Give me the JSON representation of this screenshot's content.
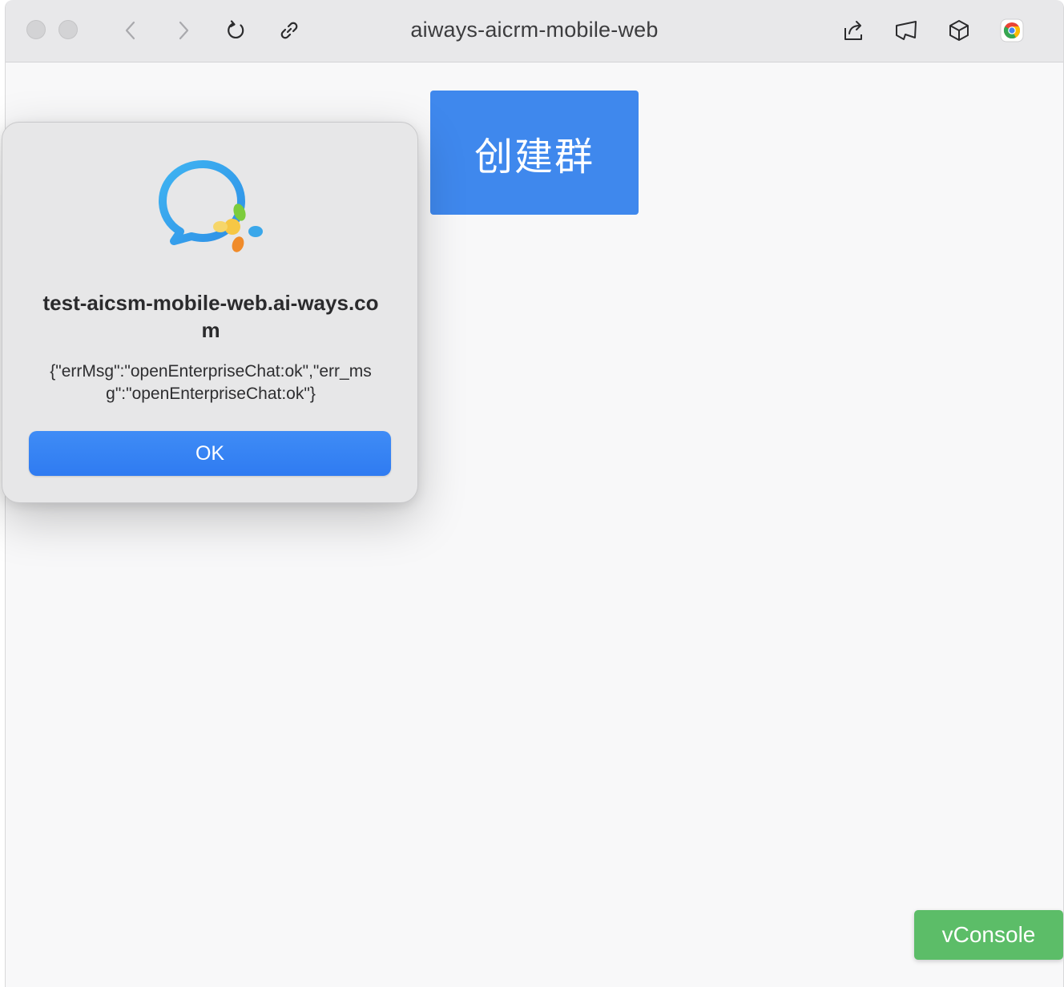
{
  "titlebar": {
    "title": "aiways-aicrm-mobile-web",
    "icons": [
      "close-dot",
      "minimize-dot",
      "back-icon",
      "forward-icon",
      "reload-icon",
      "link-icon",
      "share-icon",
      "broadcast-icon",
      "cube-icon",
      "chrome-icon"
    ]
  },
  "page": {
    "create_group_label": "创建群",
    "vconsole_label": "vConsole",
    "accent_color": "#3f88ed",
    "vconsole_color": "#5cbd68"
  },
  "dialog": {
    "icon": "wecom-icon",
    "heading": "test-aicsm-mobile-web.ai-ways.com",
    "message": "{\"errMsg\":\"openEnterpriseChat:ok\",\"err_msg\":\"openEnterpriseChat:ok\"}",
    "ok_label": "OK",
    "ok_color": "#3080f2"
  }
}
